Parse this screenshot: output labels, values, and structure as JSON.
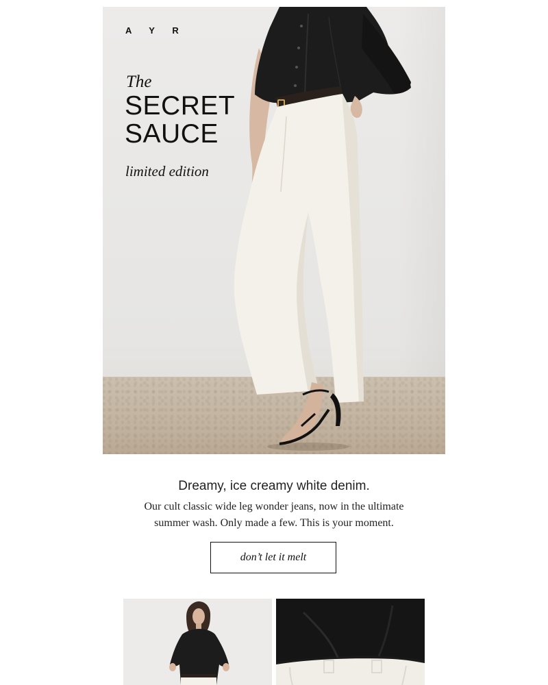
{
  "hero": {
    "logo": "A Y R",
    "title_prefix": "The",
    "title_line1": "SECRET",
    "title_line2": "SAUCE",
    "subtitle": "limited edition"
  },
  "copy": {
    "headline": "Dreamy, ice creamy white denim.",
    "body": "Our cult classic wide leg wonder jeans, now in the ultimate summer wash. Only made a few. This is your moment."
  },
  "cta": {
    "label": "don’t let it melt"
  },
  "colors": {
    "background": "#ffffff",
    "text": "#1a1a1a",
    "wall": "#ebeae8",
    "floor": "#c4b6a4",
    "shirt": "#1c1c1c",
    "denim": "#f4f1ea"
  }
}
